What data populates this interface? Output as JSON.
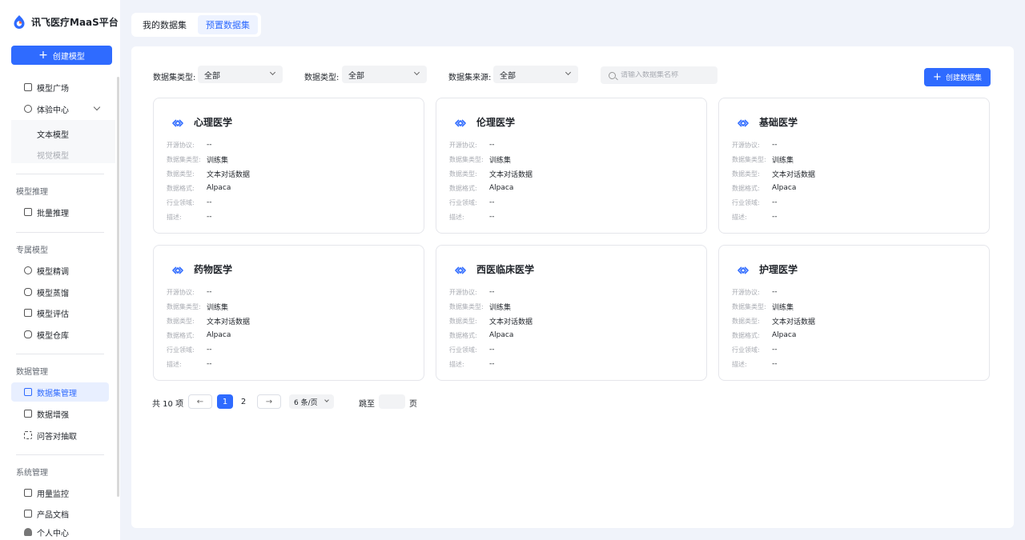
{
  "brand": {
    "name": "讯飞医疗MaaS平台"
  },
  "sidebar": {
    "create_label": "创建模型",
    "items": [
      {
        "label": "模型广场"
      },
      {
        "label": "体验中心"
      },
      {
        "label": "文本模型"
      },
      {
        "label": "视觉模型"
      },
      {
        "label": "批量推理"
      },
      {
        "label": "模型精调"
      },
      {
        "label": "模型蒸馏"
      },
      {
        "label": "模型评估"
      },
      {
        "label": "模型仓库"
      },
      {
        "label": "数据集管理"
      },
      {
        "label": "数据增强"
      },
      {
        "label": "问答对抽取"
      },
      {
        "label": "用量监控"
      },
      {
        "label": "产品文档"
      },
      {
        "label": "个人中心"
      }
    ],
    "groups": [
      "模型推理",
      "专属模型",
      "数据管理",
      "系统管理"
    ]
  },
  "tabs": [
    {
      "label": "我的数据集"
    },
    {
      "label": "预置数据集"
    }
  ],
  "filters": {
    "dataset_type_label": "数据集类型:",
    "dataset_type_value": "全部",
    "data_type_label": "数据类型:",
    "data_type_value": "全部",
    "source_label": "数据集来源:",
    "source_value": "全部",
    "search_placeholder": "请输入数据集名称",
    "create_label": "创建数据集"
  },
  "card_labels": {
    "license": "开源协议:",
    "dataset_type": "数据集类型:",
    "data_type": "数据类型:",
    "format": "数据格式:",
    "domain": "行业领域:",
    "desc": "描述:"
  },
  "cards": [
    {
      "title": "心理医学",
      "license": "--",
      "dataset_type": "训练集",
      "data_type": "文本对话数据",
      "format": "Alpaca",
      "domain": "--",
      "desc": "--"
    },
    {
      "title": "伦理医学",
      "license": "--",
      "dataset_type": "训练集",
      "data_type": "文本对话数据",
      "format": "Alpaca",
      "domain": "--",
      "desc": "--"
    },
    {
      "title": "基础医学",
      "license": "--",
      "dataset_type": "训练集",
      "data_type": "文本对话数据",
      "format": "Alpaca",
      "domain": "--",
      "desc": "--"
    },
    {
      "title": "药物医学",
      "license": "--",
      "dataset_type": "训练集",
      "data_type": "文本对话数据",
      "format": "Alpaca",
      "domain": "--",
      "desc": "--"
    },
    {
      "title": "西医临床医学",
      "license": "--",
      "dataset_type": "训练集",
      "data_type": "文本对话数据",
      "format": "Alpaca",
      "domain": "--",
      "desc": "--"
    },
    {
      "title": "护理医学",
      "license": "--",
      "dataset_type": "训练集",
      "data_type": "文本对话数据",
      "format": "Alpaca",
      "domain": "--",
      "desc": "--"
    }
  ],
  "pagination": {
    "total": "共 10 项",
    "prev": "←",
    "next": "→",
    "pages": [
      "1",
      "2"
    ],
    "page_size": "6 条/页",
    "jump_label": "跳至",
    "jump_unit": "页"
  },
  "colors": {
    "accent": "#2f6bff",
    "background": "#f0f3fa"
  }
}
